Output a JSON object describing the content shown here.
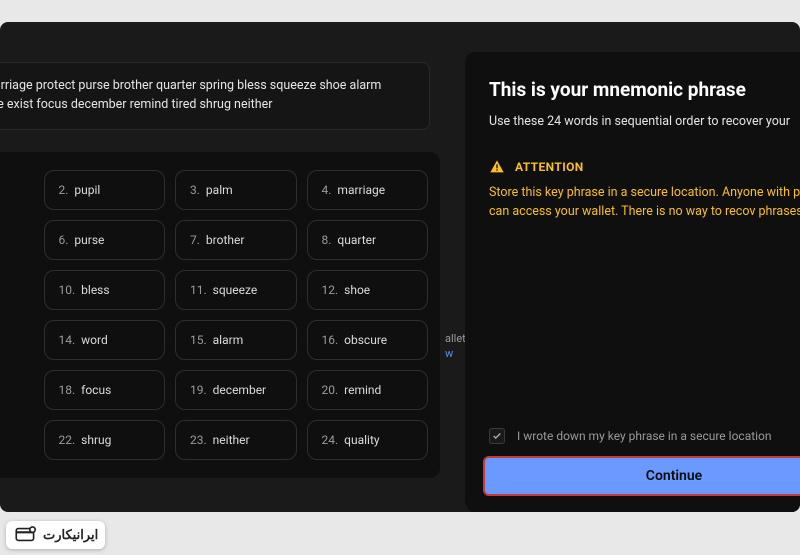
{
  "phrase_summary": "alm marriage protect purse brother quarter spring bless squeeze shoe alarm obscure exist focus december remind tired shrug neither",
  "words": [
    {
      "n": "2.",
      "w": "pupil"
    },
    {
      "n": "3.",
      "w": "palm"
    },
    {
      "n": "4.",
      "w": "marriage"
    },
    {
      "n": "6.",
      "w": "purse"
    },
    {
      "n": "7.",
      "w": "brother"
    },
    {
      "n": "8.",
      "w": "quarter"
    },
    {
      "n": "10.",
      "w": "bless"
    },
    {
      "n": "11.",
      "w": "squeeze"
    },
    {
      "n": "12.",
      "w": "shoe"
    },
    {
      "n": "14.",
      "w": "word"
    },
    {
      "n": "15.",
      "w": "alarm"
    },
    {
      "n": "16.",
      "w": "obscure"
    },
    {
      "n": "18.",
      "w": "focus"
    },
    {
      "n": "19.",
      "w": "december"
    },
    {
      "n": "20.",
      "w": "remind"
    },
    {
      "n": "22.",
      "w": "shrug"
    },
    {
      "n": "23.",
      "w": "neither"
    },
    {
      "n": "24.",
      "w": "quality"
    }
  ],
  "right": {
    "title": "This is your mnemonic phrase",
    "subtitle": "Use these 24 words in sequential order to recover your",
    "attention_label": "ATTENTION",
    "attention_text": "Store this key phrase in a secure location. Anyone with phrase can access your wallet. There is no way to recov phrases.",
    "checkbox_label": "I wrote down my key phrase in a secure location",
    "continue_label": "Continue"
  },
  "peek": {
    "wallet": "allet",
    "link": "w"
  },
  "badge": {
    "text": "ایرانیکارت"
  },
  "colors": {
    "warning": "#fbbf24",
    "primary": "#6b9aff",
    "highlight_border": "#c73a3a"
  }
}
